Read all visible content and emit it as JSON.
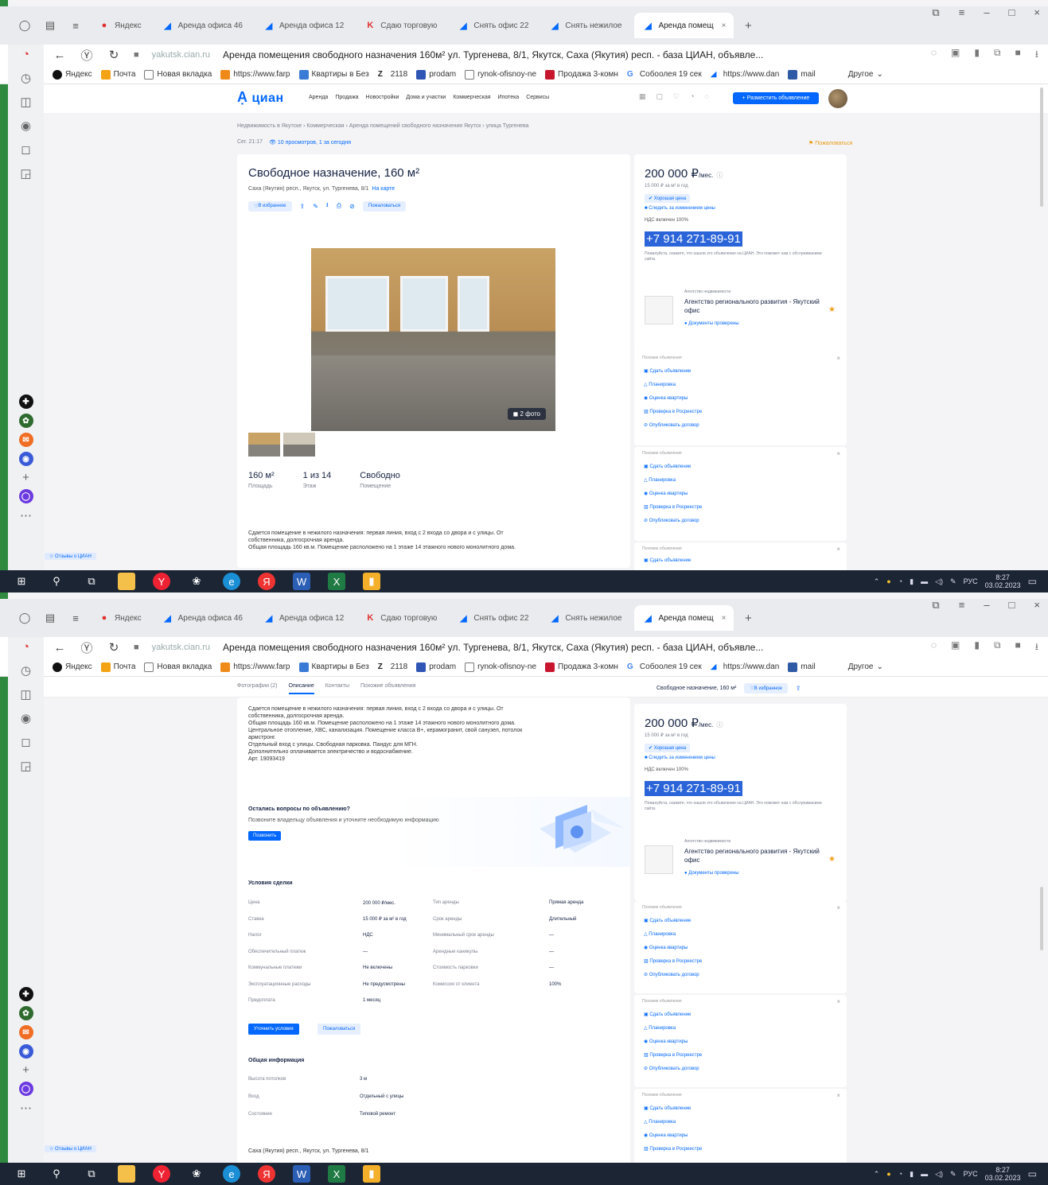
{
  "browser": {
    "tabs": [
      {
        "label": "Яндекс",
        "icon": "yandex-icon"
      },
      {
        "label": "Аренда офиса 46",
        "icon": "cian-icon"
      },
      {
        "label": "Аренда офиса 12",
        "icon": "cian-icon"
      },
      {
        "label": "Сдаю торговую",
        "icon": "k-icon"
      },
      {
        "label": "Снять офис 22",
        "icon": "cian-icon"
      },
      {
        "label": "Снять нежилое",
        "icon": "cian-icon"
      },
      {
        "label": "Аренда помещ",
        "icon": "cian-icon"
      }
    ],
    "domain": "yakutsk.cian.ru",
    "page_title": "Аренда помещения свободного назначения 160м² ул. Тургенева, 8/1, Якутск, Саха (Якутия) респ. - база ЦИАН, объявле...",
    "bookmarks": [
      "Яндекс",
      "Почта",
      "Новая вкладка",
      "https://www.farp",
      "Квартиры в Без",
      "2118",
      "prodam",
      "rynok-ofisnoy-ne",
      "Продажа 3-комн",
      "Собоолея 19 сек",
      "https://www.dan",
      "mail",
      "Другое"
    ]
  },
  "cian": {
    "logo": "циан",
    "nav": [
      "Аренда",
      "Продажа",
      "Новостройки",
      "Дома и участки",
      "Коммерческая",
      "Ипотека",
      "Сервисы"
    ],
    "post_button": "+ Разместить объявление",
    "breadcrumbs": "Недвижимость в Якутске  ›  Коммерческая  ›  Аренда помещений свободного назначения Якутск  ›  улица Тургенева",
    "listing_date": "Сег. 21:17",
    "views": "10 просмотров, 1 за сегодня",
    "complain": "Пожаловаться",
    "title": "Свободное назначение, 160 м²",
    "address": "Саха (Якутия) респ., Якутск, ул. Тургенева, 8/1",
    "map_link": "На карте",
    "favorite": "В избранное",
    "share": "Пожаловаться",
    "photo_count": "2 фото",
    "stats": [
      {
        "value": "160 м²",
        "label": "Площадь"
      },
      {
        "value": "1 из 14",
        "label": "Этаж"
      },
      {
        "value": "Свободно",
        "label": "Помещение"
      }
    ],
    "description": [
      "Сдается помещение в нежилого назначения: первая линия, вход с 2 входа со двора и с улицы. От",
      "собственника, долгосрочная аренда.",
      "Общая площадь 160 кв.м. Помещение расположено на 1 этаже 14 этажного нового монолитного дома.",
      "Центральное отопление, ХВС, канализация. Помещение класса В+, керамогранит, свой санузел, потолок",
      "армстронг.",
      "Отдельный вход с улицы. Свободная парковка. Пандус для МГН.",
      "Дополнительно оплачивается электричество и водоснабжение.",
      "Арт. 19093419"
    ],
    "price": "200 000 ₽",
    "price_unit": "/мес.",
    "price_per_m": "15 000 ₽ за м² в год",
    "price_badge": "Хорошая цена",
    "compare": "Следить за изменением цены",
    "vat": "НДС включен 100%",
    "phone": "+7 914 271-89-91",
    "phone_note": "Пожалуйста, скажите, что нашли это объявление на ЦИАН. Это поможет нам с обслуживанием сайта.",
    "agent_type": "Агентство недвижимости",
    "agent_name": "Агентство регионального развития - Якутский офис",
    "agent_docs": "Документы проверены",
    "similar": [
      {
        "header": "Похожие объявления",
        "rows": [
          "Сдать объявление",
          "Планировка",
          "Оценка квартиры",
          "Проверка в Росреестре",
          "Опубликовать договор"
        ]
      },
      {
        "header": "Похожие объявления",
        "rows": [
          "Сдать объявление",
          "Планировка",
          "Оценка квартиры",
          "Проверка в Росреестре",
          "Опубликовать договор"
        ]
      },
      {
        "header": "Похожие объявления",
        "rows": [
          "Сдать объявление"
        ]
      }
    ],
    "intro_chip": "Отзывы о ЦИАН",
    "sticky_tabs": [
      "Фотографии (2)",
      "Описание",
      "Контакты",
      "Похожие объявления"
    ],
    "sticky_title": "Свободное назначение, 160 м²",
    "question_title": "Остались вопросы по объявлению?",
    "question_sub": "Позвоните владельцу объявления и уточните необходимую информацию",
    "question_btn": "Позвонить",
    "terms_title": "Условия сделки",
    "terms": [
      [
        "Цена",
        "200 000 ₽/мес.",
        "Тип аренды",
        "Прямая аренда"
      ],
      [
        "Ставка",
        "15 000 ₽ за м² в год",
        "Срок аренды",
        "Длительный"
      ],
      [
        "Налог",
        "НДС",
        "Минимальный срок аренды",
        "—"
      ],
      [
        "Обеспечительный платеж",
        "—",
        "Арендные каникулы",
        "—"
      ],
      [
        "Коммунальные платежи",
        "Не включены",
        "Стоимость парковки",
        "—"
      ],
      [
        "Эксплуатационные расходы",
        "Не предусмотрены",
        "Комиссия от клиента",
        "100%"
      ],
      [
        "Предоплата",
        "1 месяц",
        "",
        ""
      ]
    ],
    "terms_btn1": "Уточнить условия",
    "terms_btn2": "Пожаловаться",
    "info_title": "Общая информация",
    "info": [
      [
        "Высота потолков",
        "3 м"
      ],
      [
        "Вход",
        "Отдельный с улицы"
      ],
      [
        "Состояние",
        "Типовой ремонт"
      ]
    ],
    "bottom_address": "Саха (Якутия) респ., Якутск, ул. Тургенева, 8/1"
  },
  "taskbar": {
    "time": "8:27",
    "date": "03.02.2023",
    "lang": "РУС"
  }
}
